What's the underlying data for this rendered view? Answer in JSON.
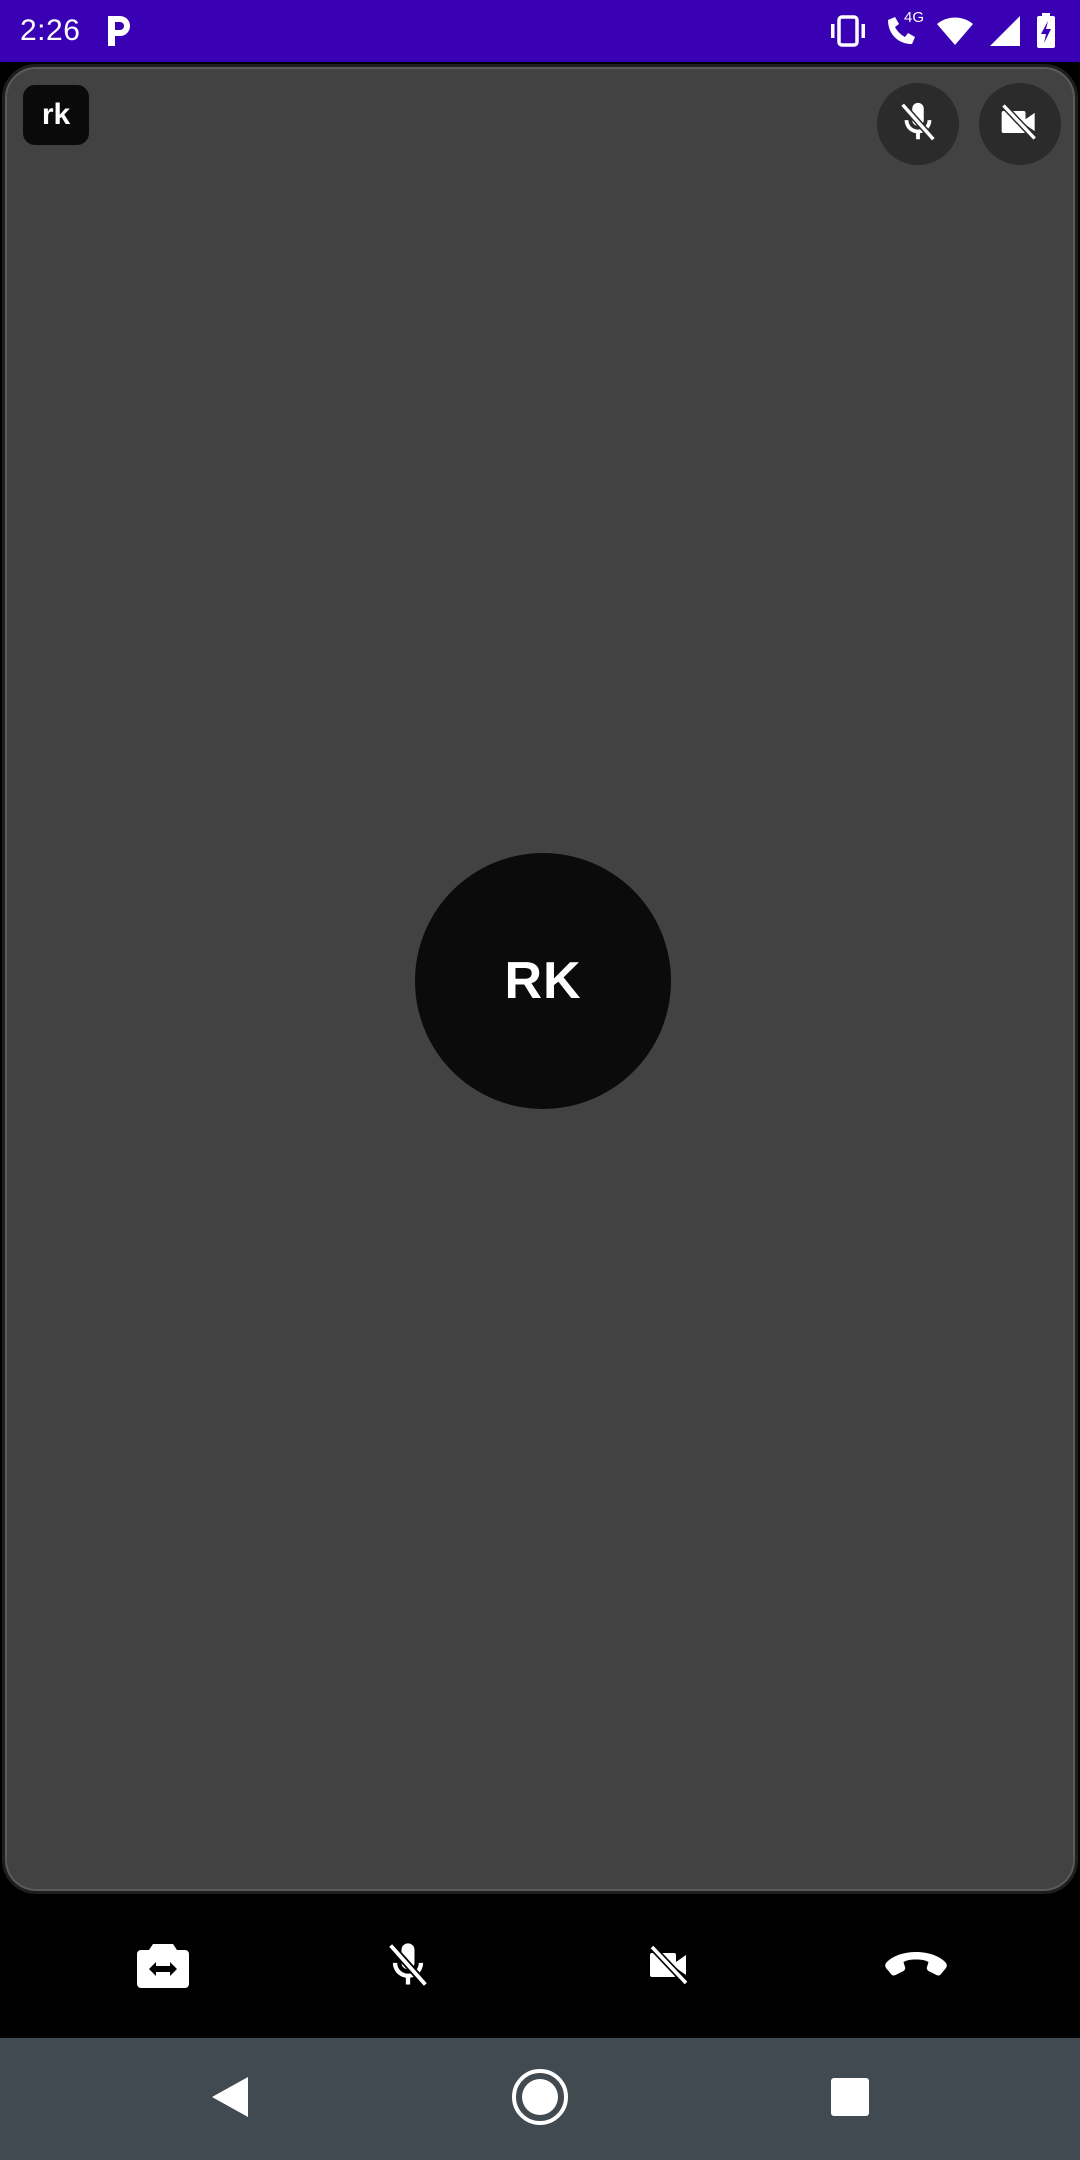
{
  "status_bar": {
    "time": "2:26",
    "network_label": "4G",
    "app_icon": "p-icon",
    "icons": [
      "vibrate-icon",
      "wifi-calling-icon",
      "wifi-icon",
      "cellular-signal-icon",
      "battery-charging-icon"
    ],
    "background": "#3a00b4"
  },
  "participant": {
    "name_tag": "rk",
    "initials": "RK",
    "mic_state_icon": "mic-off-icon",
    "camera_state_icon": "video-off-icon"
  },
  "controls": {
    "switch_camera_icon": "switch-camera-icon",
    "mic_icon": "mic-off-icon",
    "camera_icon": "video-off-icon",
    "hangup_icon": "hang-up-icon"
  },
  "nav_bar": {
    "icons": [
      "back-icon",
      "home-icon",
      "recents-icon"
    ],
    "background": "#424a51"
  },
  "colors": {
    "tile_background": "#424242",
    "avatar_background": "#0b0b0b",
    "controls_background": "#000000"
  }
}
